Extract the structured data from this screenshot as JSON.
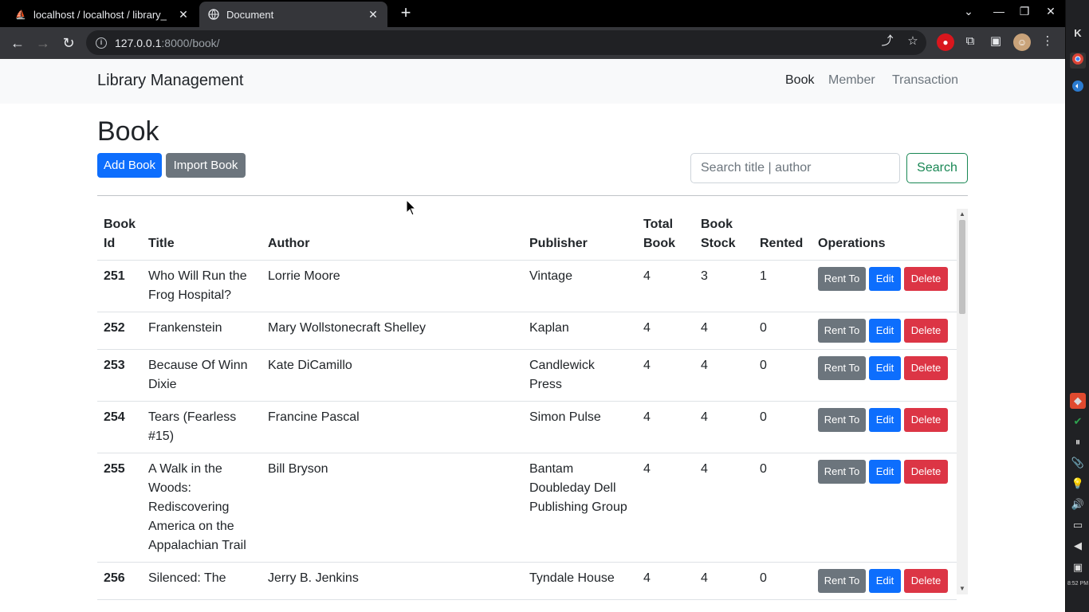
{
  "browser": {
    "tabs": [
      {
        "title": "localhost / localhost / library_",
        "active": false
      },
      {
        "title": "Document",
        "active": true
      }
    ],
    "url_host": "127.0.0.1",
    "url_path": ":8000/book/"
  },
  "navbar": {
    "brand": "Library Management",
    "links": [
      "Book",
      "Member",
      "Transaction"
    ],
    "active": "Book"
  },
  "page": {
    "title": "Book",
    "add_button": "Add Book",
    "import_button": "Import Book",
    "search_placeholder": "Search title | author",
    "search_button": "Search"
  },
  "table": {
    "headers": [
      "Book Id",
      "Title",
      "Author",
      "Publisher",
      "Total Book",
      "Book Stock",
      "Rented",
      "Operations"
    ],
    "ops_labels": {
      "rent": "Rent To",
      "edit": "Edit",
      "delete": "Delete"
    },
    "rows": [
      {
        "id": "251",
        "title": "Who Will Run the Frog Hospital?",
        "author": "Lorrie Moore",
        "publisher": "Vintage",
        "total": "4",
        "stock": "3",
        "rented": "1"
      },
      {
        "id": "252",
        "title": "Frankenstein",
        "author": "Mary Wollstonecraft Shelley",
        "publisher": "Kaplan",
        "total": "4",
        "stock": "4",
        "rented": "0"
      },
      {
        "id": "253",
        "title": "Because Of Winn Dixie",
        "author": "Kate DiCamillo",
        "publisher": "Candlewick Press",
        "total": "4",
        "stock": "4",
        "rented": "0"
      },
      {
        "id": "254",
        "title": "Tears (Fearless #15)",
        "author": "Francine Pascal",
        "publisher": "Simon Pulse",
        "total": "4",
        "stock": "4",
        "rented": "0"
      },
      {
        "id": "255",
        "title": "A Walk in the Woods: Rediscovering America on the Appalachian Trail",
        "author": "Bill Bryson",
        "publisher": "Bantam Doubleday Dell Publishing Group",
        "total": "4",
        "stock": "4",
        "rented": "0"
      },
      {
        "id": "256",
        "title": "Silenced: The",
        "author": "Jerry B. Jenkins",
        "publisher": "Tyndale House",
        "total": "4",
        "stock": "4",
        "rented": "0"
      }
    ]
  },
  "dock": {
    "time": "8:52 PM"
  },
  "colors": {
    "primary": "#0d6efd",
    "secondary": "#6c757d",
    "danger": "#dc3545",
    "success": "#198754"
  }
}
